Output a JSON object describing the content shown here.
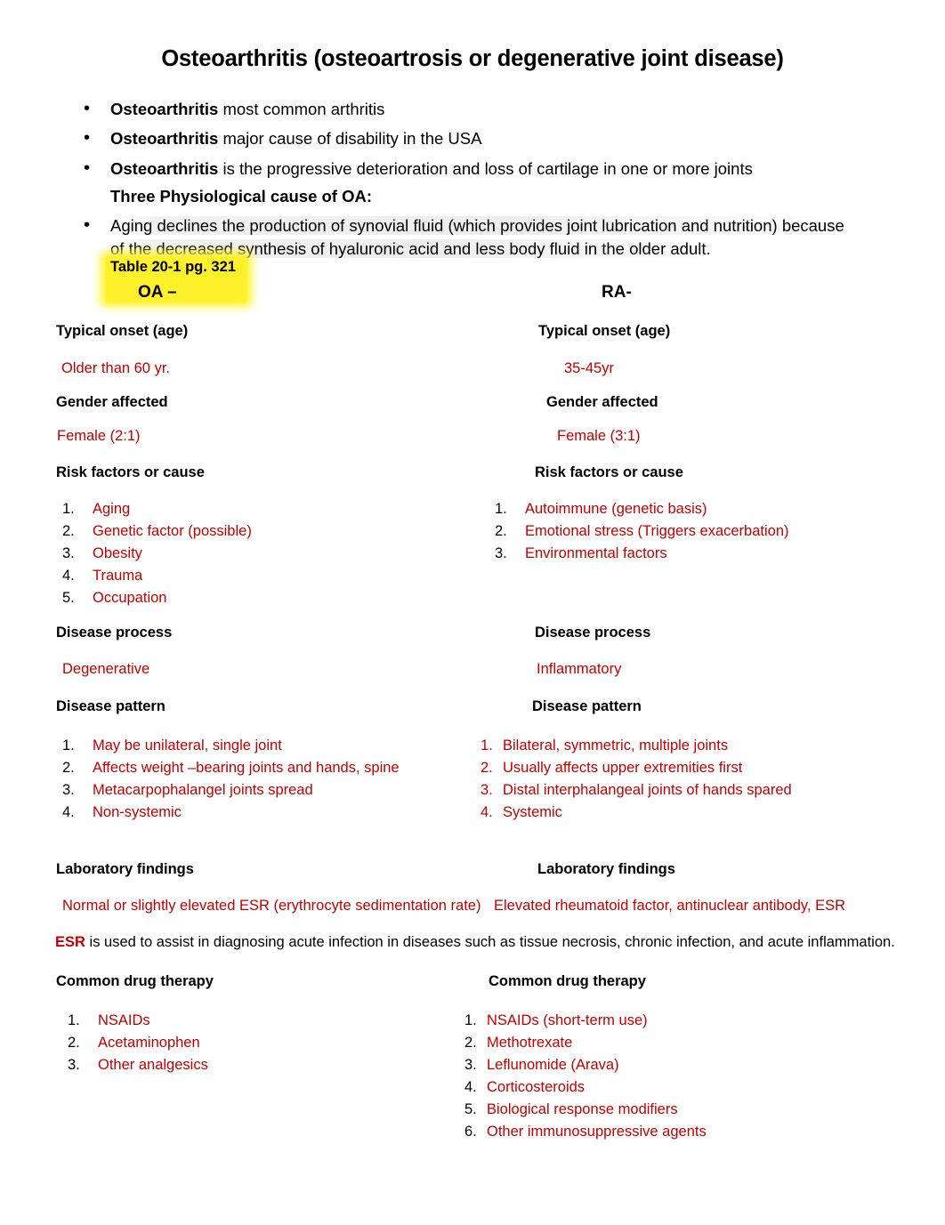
{
  "document": {
    "title": "Osteoarthritis (osteoartrosis or degenerative joint disease)",
    "intro_bullets": [
      {
        "bold": "Osteoarthritis",
        "rest": " most common arthritis"
      },
      {
        "bold": "Osteoarthritis",
        "rest": " major cause of disability in the USA"
      },
      {
        "bold": "Osteoarthritis",
        "rest": " is the progressive deterioration and loss of cartilage in one or more joints"
      }
    ],
    "subheading": "Three Physiological cause of OA:",
    "aging_paragraph_line1": "Aging declines the production of synovial fluid (which provides joint lubrication and nutrition) because",
    "aging_paragraph_line2": "of the decreased synthesis of hyaluronic acid and less body fluid in the older adult.",
    "table_reference": "Table 20-1 pg. 321",
    "highlight_color": "#FFF22D",
    "red_color": "#C00000"
  },
  "comparison": {
    "column_headers": {
      "oa": "OA –",
      "ra": "RA-"
    },
    "rows": [
      {
        "label": "Typical onset (age)",
        "oa_value": "Older than 60 yr.",
        "ra_value": "35-45yr"
      },
      {
        "label": "Gender affected",
        "oa_value": "Female (2:1)",
        "ra_value": "Female (3:1)"
      },
      {
        "label": "Risk factors or cause",
        "oa_items": [
          "Aging",
          "Genetic factor (possible)",
          "Obesity",
          "Trauma",
          "Occupation"
        ],
        "ra_items": [
          "Autoimmune (genetic basis)",
          "Emotional stress (Triggers exacerbation)",
          " Environmental factors"
        ]
      },
      {
        "label": "Disease process",
        "oa_value": "Degenerative",
        "ra_value": "Inflammatory"
      },
      {
        "label": "Disease pattern",
        "oa_items": [
          "May be unilateral, single joint",
          "Affects weight –bearing joints and hands, spine",
          " Metacarpophalangel joints spread",
          "Non-systemic"
        ],
        "ra_items": [
          " Bilateral, symmetric, multiple joints",
          "Usually affects upper extremities first",
          "Distal interphalangeal joints of hands spared",
          "Systemic"
        ]
      },
      {
        "label": "Laboratory findings",
        "oa_value": "Normal or slightly elevated ESR (erythrocyte sedimentation rate)",
        "ra_value": "Elevated rheumatoid factor, antinuclear antibody, ESR"
      },
      {
        "label": "Common drug therapy",
        "oa_items": [
          "NSAIDs",
          "Acetaminophen",
          "Other analgesics"
        ],
        "ra_items": [
          "NSAIDs (short-term use)",
          "Methotrexate",
          "Leflunomide (Arava)",
          "Corticosteroids",
          "Biological response modifiers",
          "Other immunosuppressive agents"
        ]
      }
    ],
    "numbers": [
      "1.",
      "2.",
      "3.",
      "4.",
      "5.",
      "6."
    ]
  },
  "esr_note": {
    "term": "ESR",
    "text": " is used to assist in diagnosing acute infection in diseases such as tissue necrosis, chronic infection, and acute inflammation."
  }
}
